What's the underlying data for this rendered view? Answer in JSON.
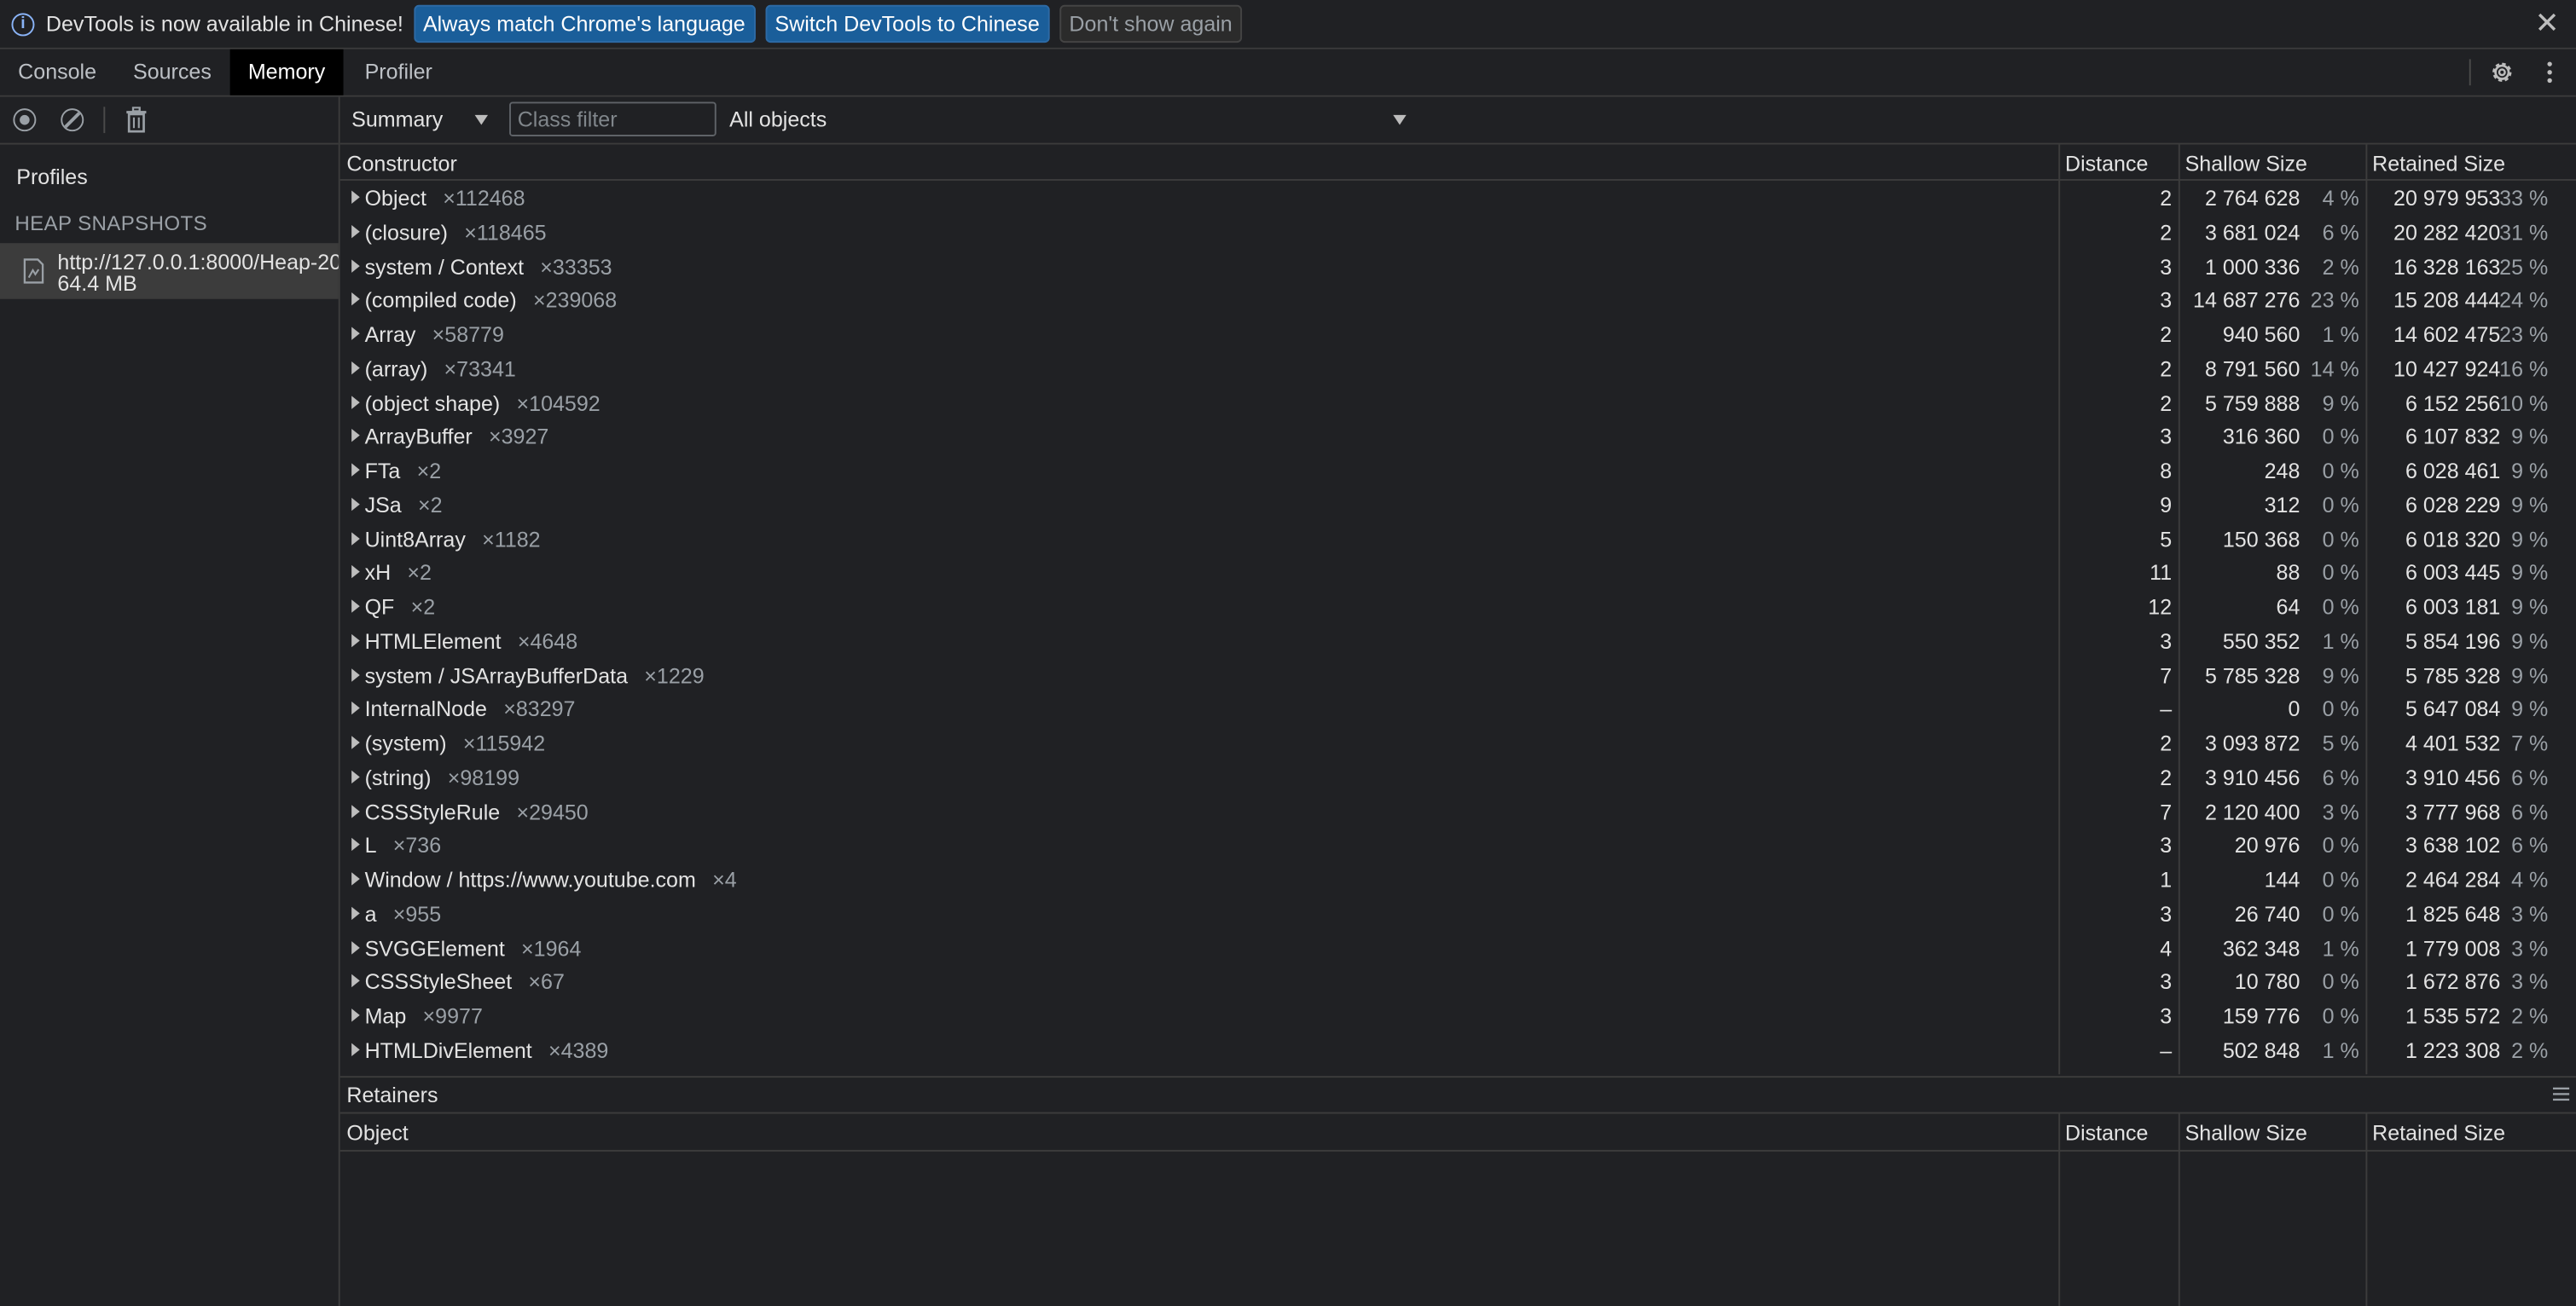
{
  "infobar": {
    "message": "DevTools is now available in Chinese!",
    "btn_match": "Always match Chrome's language",
    "btn_switch": "Switch DevTools to Chinese",
    "btn_dismiss": "Don't show again",
    "info_icon": "info-icon",
    "close_icon": "close-icon"
  },
  "tabs": [
    {
      "label": "Console"
    },
    {
      "label": "Sources"
    },
    {
      "label": "Memory",
      "active": true
    },
    {
      "label": "Profiler"
    }
  ],
  "sidebar": {
    "profiles_title": "Profiles",
    "heap_snapshots_title": "HEAP SNAPSHOTS",
    "snapshot": {
      "url": "http://127.0.0.1:8000/Heap-20",
      "size": "64.4 MB"
    }
  },
  "toolbar": {
    "view": "Summary",
    "class_filter_placeholder": "Class filter",
    "objects_filter": "All objects"
  },
  "columns": {
    "constructor": "Constructor",
    "distance": "Distance",
    "shallow": "Shallow Size",
    "retained": "Retained Size"
  },
  "rows": [
    {
      "name": "Object",
      "count": "×112468",
      "distance": "2",
      "shallow": "2 764 628",
      "shallow_pct": "4 %",
      "retained": "20 979 953",
      "retained_pct": "33 %"
    },
    {
      "name": "(closure)",
      "count": "×118465",
      "distance": "2",
      "shallow": "3 681 024",
      "shallow_pct": "6 %",
      "retained": "20 282 420",
      "retained_pct": "31 %"
    },
    {
      "name": "system / Context",
      "count": "×33353",
      "distance": "3",
      "shallow": "1 000 336",
      "shallow_pct": "2 %",
      "retained": "16 328 163",
      "retained_pct": "25 %"
    },
    {
      "name": "(compiled code)",
      "count": "×239068",
      "distance": "3",
      "shallow": "14 687 276",
      "shallow_pct": "23 %",
      "retained": "15 208 444",
      "retained_pct": "24 %"
    },
    {
      "name": "Array",
      "count": "×58779",
      "distance": "2",
      "shallow": "940 560",
      "shallow_pct": "1 %",
      "retained": "14 602 475",
      "retained_pct": "23 %"
    },
    {
      "name": "(array)",
      "count": "×73341",
      "distance": "2",
      "shallow": "8 791 560",
      "shallow_pct": "14 %",
      "retained": "10 427 924",
      "retained_pct": "16 %"
    },
    {
      "name": "(object shape)",
      "count": "×104592",
      "distance": "2",
      "shallow": "5 759 888",
      "shallow_pct": "9 %",
      "retained": "6 152 256",
      "retained_pct": "10 %"
    },
    {
      "name": "ArrayBuffer",
      "count": "×3927",
      "distance": "3",
      "shallow": "316 360",
      "shallow_pct": "0 %",
      "retained": "6 107 832",
      "retained_pct": "9 %"
    },
    {
      "name": "FTa",
      "count": "×2",
      "distance": "8",
      "shallow": "248",
      "shallow_pct": "0 %",
      "retained": "6 028 461",
      "retained_pct": "9 %"
    },
    {
      "name": "JSa",
      "count": "×2",
      "distance": "9",
      "shallow": "312",
      "shallow_pct": "0 %",
      "retained": "6 028 229",
      "retained_pct": "9 %"
    },
    {
      "name": "Uint8Array",
      "count": "×1182",
      "distance": "5",
      "shallow": "150 368",
      "shallow_pct": "0 %",
      "retained": "6 018 320",
      "retained_pct": "9 %"
    },
    {
      "name": "xH",
      "count": "×2",
      "distance": "11",
      "shallow": "88",
      "shallow_pct": "0 %",
      "retained": "6 003 445",
      "retained_pct": "9 %"
    },
    {
      "name": "QF",
      "count": "×2",
      "distance": "12",
      "shallow": "64",
      "shallow_pct": "0 %",
      "retained": "6 003 181",
      "retained_pct": "9 %"
    },
    {
      "name": "HTMLElement",
      "count": "×4648",
      "distance": "3",
      "shallow": "550 352",
      "shallow_pct": "1 %",
      "retained": "5 854 196",
      "retained_pct": "9 %"
    },
    {
      "name": "system / JSArrayBufferData",
      "count": "×1229",
      "distance": "7",
      "shallow": "5 785 328",
      "shallow_pct": "9 %",
      "retained": "5 785 328",
      "retained_pct": "9 %"
    },
    {
      "name": "InternalNode",
      "count": "×83297",
      "distance": "–",
      "shallow": "0",
      "shallow_pct": "0 %",
      "retained": "5 647 084",
      "retained_pct": "9 %"
    },
    {
      "name": "(system)",
      "count": "×115942",
      "distance": "2",
      "shallow": "3 093 872",
      "shallow_pct": "5 %",
      "retained": "4 401 532",
      "retained_pct": "7 %"
    },
    {
      "name": "(string)",
      "count": "×98199",
      "distance": "2",
      "shallow": "3 910 456",
      "shallow_pct": "6 %",
      "retained": "3 910 456",
      "retained_pct": "6 %"
    },
    {
      "name": "CSSStyleRule",
      "count": "×29450",
      "distance": "7",
      "shallow": "2 120 400",
      "shallow_pct": "3 %",
      "retained": "3 777 968",
      "retained_pct": "6 %"
    },
    {
      "name": "L",
      "count": "×736",
      "distance": "3",
      "shallow": "20 976",
      "shallow_pct": "0 %",
      "retained": "3 638 102",
      "retained_pct": "6 %"
    },
    {
      "name": "Window / https://www.youtube.com",
      "count": "×4",
      "distance": "1",
      "shallow": "144",
      "shallow_pct": "0 %",
      "retained": "2 464 284",
      "retained_pct": "4 %"
    },
    {
      "name": "a",
      "count": "×955",
      "distance": "3",
      "shallow": "26 740",
      "shallow_pct": "0 %",
      "retained": "1 825 648",
      "retained_pct": "3 %"
    },
    {
      "name": "SVGGElement",
      "count": "×1964",
      "distance": "4",
      "shallow": "362 348",
      "shallow_pct": "1 %",
      "retained": "1 779 008",
      "retained_pct": "3 %"
    },
    {
      "name": "CSSStyleSheet",
      "count": "×67",
      "distance": "3",
      "shallow": "10 780",
      "shallow_pct": "0 %",
      "retained": "1 672 876",
      "retained_pct": "3 %"
    },
    {
      "name": "Map",
      "count": "×9977",
      "distance": "3",
      "shallow": "159 776",
      "shallow_pct": "0 %",
      "retained": "1 535 572",
      "retained_pct": "2 %"
    },
    {
      "name": "HTMLDivElement",
      "count": "×4389",
      "distance": "–",
      "shallow": "502 848",
      "shallow_pct": "1 %",
      "retained": "1 223 308",
      "retained_pct": "2 %"
    }
  ],
  "retainers": {
    "title": "Retainers",
    "columns": {
      "object": "Object",
      "distance": "Distance",
      "shallow": "Shallow Size",
      "retained": "Retained Size"
    }
  },
  "icons": {
    "settings": "gear-icon",
    "more": "kebab-menu-icon",
    "record": "record-icon",
    "clear": "clear-icon",
    "trash": "trash-icon",
    "snapshot": "heap-snapshot-icon"
  },
  "colors": {
    "background": "#202124",
    "primary_button": "#1a5e9a",
    "selected_snapshot": "#3c3c3c",
    "active_tab": "#000000"
  }
}
